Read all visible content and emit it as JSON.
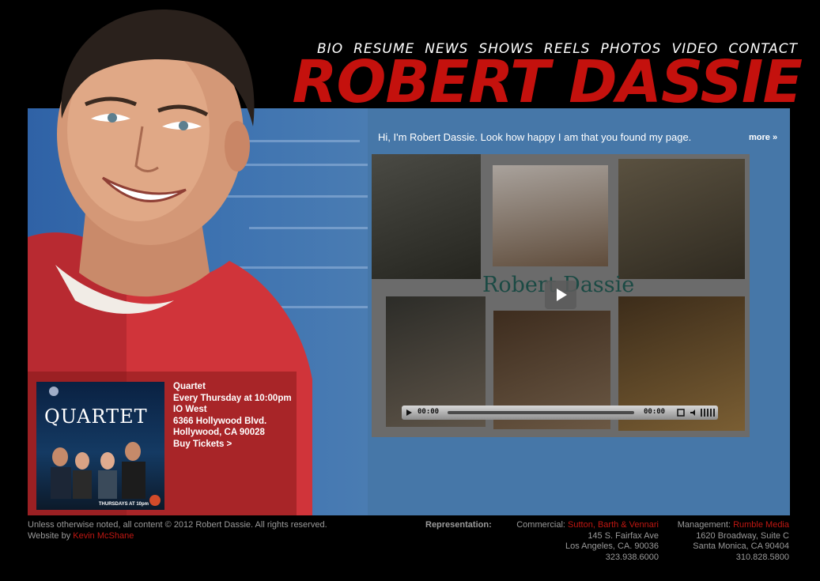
{
  "nav": {
    "items": [
      "BIO",
      "RESUME",
      "NEWS",
      "SHOWS",
      "REELS",
      "PHOTOS",
      "VIDEO",
      "CONTACT"
    ]
  },
  "site": {
    "title": "ROBERT DASSIE"
  },
  "intro": {
    "text": "Hi, I'm Robert Dassie. Look how happy I am that you found my page.",
    "more_label": "more »"
  },
  "video": {
    "title": "Robert Dassie",
    "current_time": "00:00",
    "duration": "00:00"
  },
  "show": {
    "title": "Quartet",
    "schedule": "Every Thursday at 10:00pm",
    "venue": "IO West",
    "address1": "6366 Hollywood Blvd.",
    "address2": "Hollywood, CA 90028",
    "tickets_label": "Buy Tickets >",
    "poster": {
      "title": "QUARTET",
      "footer": "THURSDAYS AT 10pm"
    }
  },
  "footer": {
    "copyright": "Unless otherwise noted, all content © 2012 Robert Dassie.  All rights reserved.",
    "website_by_label": "Website by",
    "website_by_name": "Kevin McShane",
    "representation_label": "Representation:",
    "commercial": {
      "label": "Commercial:",
      "agency": "Sutton, Barth & Vennari",
      "address1": "145 S. Fairfax Ave",
      "address2": "Los Angeles, CA. 90036",
      "phone": "323.938.6000"
    },
    "management": {
      "label": "Management:",
      "agency": "Rumble Media",
      "address1": "1620 Broadway, Suite C",
      "address2": "Santa Monica, CA 90404",
      "phone": "310.828.5800"
    }
  },
  "colors": {
    "brand_red": "#c4110d",
    "stage_blue": "#4677a8",
    "background": "#000000"
  }
}
